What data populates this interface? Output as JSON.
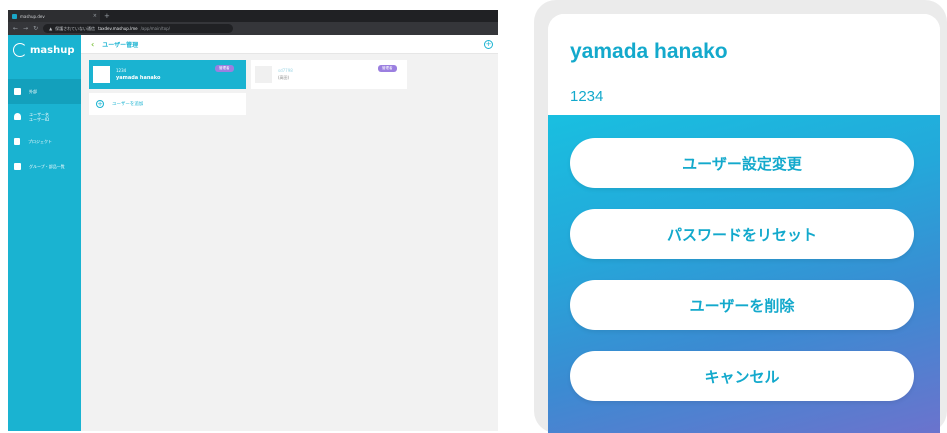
{
  "browser": {
    "tab_title": "mashup.dev",
    "address": {
      "security_note": "保護されていない通信",
      "host": "taxdev.mashup.lme",
      "path": "/app/main/top/"
    }
  },
  "sidebar": {
    "logo_text": "mashup",
    "items": [
      {
        "label": "外部",
        "icon": "home-icon",
        "active": true
      },
      {
        "label": "ユーザー名\nユーザーID",
        "icon": "person-icon",
        "active": false
      },
      {
        "label": "プロジェクト",
        "icon": "document-icon",
        "active": false
      },
      {
        "label": "グループ・部品一覧",
        "icon": "grid-icon",
        "active": false
      }
    ]
  },
  "topbar": {
    "title": "ユーザー管理"
  },
  "user_cards": [
    {
      "id": "1234",
      "name": "yamada hanako",
      "badge": "管理者",
      "selected": true
    },
    {
      "id": "sd7798",
      "name": "(高田)",
      "badge": "管理者",
      "selected": false
    }
  ],
  "add_user_label": "ユーザーを追加",
  "action_sheet": {
    "name": "yamada hanako",
    "id": "1234",
    "buttons": [
      {
        "label": "ユーザー設定変更"
      },
      {
        "label": "パスワードをリセット"
      },
      {
        "label": "ユーザーを削除"
      },
      {
        "label": "キャンセル"
      }
    ]
  },
  "colors": {
    "accent": "#1ab3d1",
    "badge": "#9b7fe0",
    "gradient_start": "#19bfe0",
    "gradient_end": "#6b73cd"
  }
}
